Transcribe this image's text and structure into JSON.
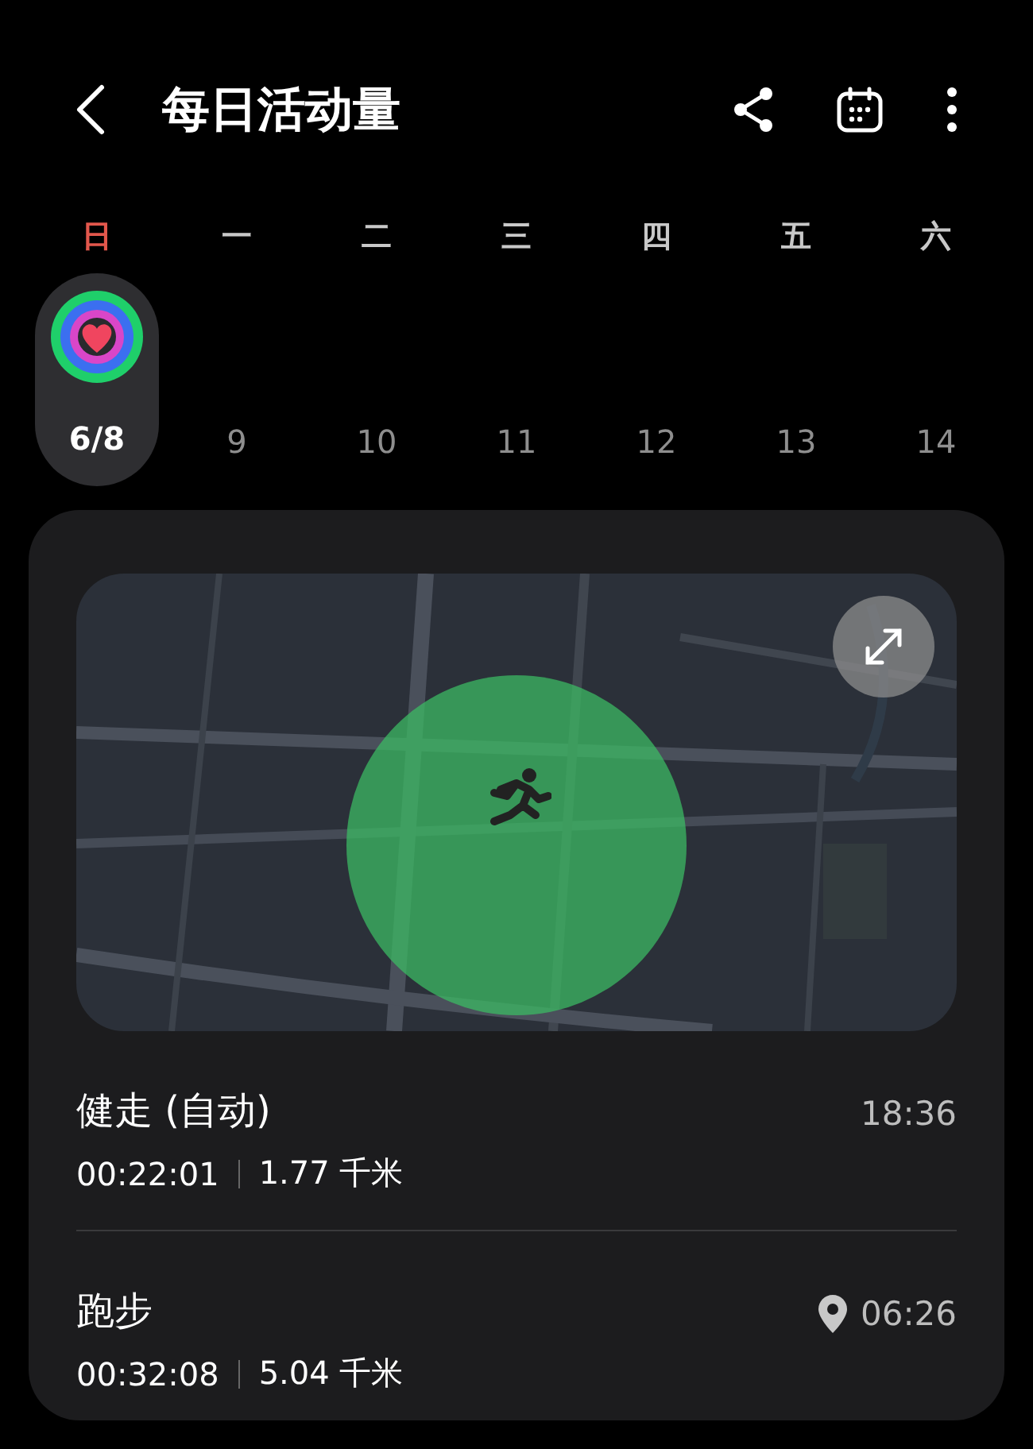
{
  "header": {
    "title": "每日活动量"
  },
  "week": [
    {
      "weekday": "日",
      "date": "6/8",
      "selected": true,
      "color": "#e2574c"
    },
    {
      "weekday": "一",
      "date": "9",
      "selected": false,
      "color": "#c8c8c8"
    },
    {
      "weekday": "二",
      "date": "10",
      "selected": false,
      "color": "#c8c8c8"
    },
    {
      "weekday": "三",
      "date": "11",
      "selected": false,
      "color": "#c8c8c8"
    },
    {
      "weekday": "四",
      "date": "12",
      "selected": false,
      "color": "#c8c8c8"
    },
    {
      "weekday": "五",
      "date": "13",
      "selected": false,
      "color": "#c8c8c8"
    },
    {
      "weekday": "六",
      "date": "14",
      "selected": false,
      "color": "#c8c8c8"
    }
  ],
  "activities": [
    {
      "name": "健走 (自动)",
      "duration": "00:22:01",
      "distance": "1.77 千米",
      "time": "18:36",
      "location": false
    },
    {
      "name": "跑步",
      "duration": "00:32:08",
      "distance": "5.04 千米",
      "time": "06:26",
      "location": true
    }
  ]
}
